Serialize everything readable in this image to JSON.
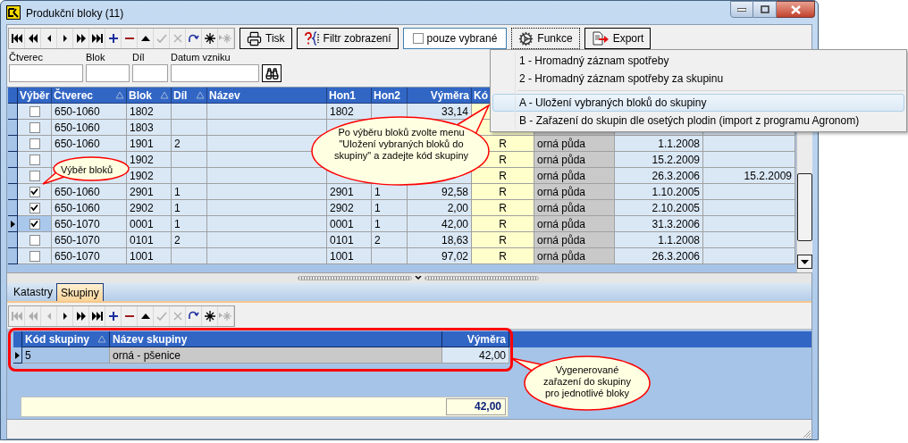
{
  "window": {
    "title": "Produkční bloky (11)"
  },
  "toolbar": {
    "nav_buttons": [
      {
        "kind": "first",
        "disabled": false
      },
      {
        "kind": "prev_page",
        "disabled": false
      },
      {
        "kind": "prev",
        "disabled": false
      },
      {
        "kind": "next",
        "disabled": false
      },
      {
        "kind": "next_page",
        "disabled": false
      },
      {
        "kind": "last",
        "disabled": false
      },
      {
        "kind": "add",
        "disabled": false
      },
      {
        "kind": "delete",
        "disabled": false
      },
      {
        "kind": "up",
        "disabled": false
      },
      {
        "kind": "confirm",
        "disabled": true
      },
      {
        "kind": "cancel",
        "disabled": true
      },
      {
        "kind": "refresh",
        "disabled": false
      },
      {
        "kind": "new",
        "disabled": false
      },
      {
        "kind": "insert",
        "disabled": true
      }
    ],
    "buttons": [
      {
        "kind": "print",
        "label": "Tisk",
        "focused": false
      },
      {
        "kind": "filter",
        "label": "Filtr zobrazení",
        "focused": false
      },
      {
        "kind": "check",
        "label": "pouze vybrané",
        "checked": false,
        "focused": false
      },
      {
        "kind": "functions",
        "label": "Funkce",
        "focused": true
      },
      {
        "kind": "export",
        "label": "Export",
        "focused": false
      }
    ]
  },
  "filters": [
    {
      "label": "Čtverec"
    },
    {
      "label": "Blok"
    },
    {
      "label": "Díl"
    },
    {
      "label": "Datum vzniku"
    }
  ],
  "grid": {
    "columns": [
      {
        "label": "Výběr",
        "sortable": false
      },
      {
        "label": "Čtverec",
        "sortable": true
      },
      {
        "label": "Blok",
        "sortable": true
      },
      {
        "label": "Díl",
        "sortable": true
      },
      {
        "label": "Název",
        "sortable": false
      },
      {
        "label": "Hon1",
        "sortable": false
      },
      {
        "label": "Hon2",
        "sortable": false
      },
      {
        "label": "Výměra",
        "sortable": false
      },
      {
        "label": "Kó"
      }
    ],
    "rows": [
      {
        "checked": false,
        "current": false,
        "cells": [
          "",
          "650-1060",
          "1802",
          "",
          "",
          "1802",
          "",
          "33,14",
          "",
          null,
          null,
          null
        ]
      },
      {
        "checked": false,
        "current": false,
        "cells": [
          "",
          "650-1060",
          "1803",
          "",
          "",
          "",
          null,
          "",
          "",
          "",
          "",
          ""
        ]
      },
      {
        "checked": false,
        "current": false,
        "cells": [
          "",
          "650-1060",
          "1901",
          "2",
          "",
          "",
          "",
          "",
          "R",
          "orná půda",
          "1.1.2008",
          ""
        ]
      },
      {
        "checked": false,
        "current": false,
        "cells": [
          "",
          "",
          "1902",
          "",
          "",
          "",
          "",
          "",
          "R",
          "orná půda",
          "15.2.2009",
          ""
        ]
      },
      {
        "checked": false,
        "current": false,
        "cells": [
          "",
          "",
          "1902",
          "",
          "",
          "",
          "",
          "",
          "R",
          "orná půda",
          "26.3.2006",
          "15.2.2009"
        ]
      },
      {
        "checked": true,
        "current": false,
        "cells": [
          "",
          "650-1060",
          "2901",
          "1",
          "",
          "2901",
          "1",
          "92,58",
          "R",
          "orná půda",
          "1.10.2005",
          ""
        ]
      },
      {
        "checked": true,
        "current": false,
        "cells": [
          "",
          "650-1060",
          "2902",
          "1",
          "",
          "2902",
          "1",
          "2,00",
          "R",
          "orná půda",
          "2.10.2005",
          ""
        ]
      },
      {
        "checked": true,
        "current": true,
        "cells": [
          "",
          "650-1070",
          "0001",
          "1",
          "",
          "0001",
          "1",
          "42,00",
          "R",
          "orná půda",
          "31.3.2006",
          ""
        ]
      },
      {
        "checked": false,
        "current": false,
        "cells": [
          "",
          "650-1070",
          "0101",
          "2",
          "",
          "0101",
          "2",
          "18,63",
          "R",
          "orná půda",
          "1.1.2008",
          ""
        ]
      },
      {
        "checked": false,
        "current": false,
        "cells": [
          "",
          "650-1070",
          "1001",
          "",
          "",
          "1001",
          "",
          "97,02",
          "R",
          "orná půda",
          "26.3.2006",
          ""
        ]
      }
    ]
  },
  "menu": {
    "items": [
      {
        "kind": "item",
        "label": "1 - Hromadný záznam spotřeby",
        "selected": false
      },
      {
        "kind": "item",
        "label": "2 - Hromadný záznam spotřeby za skupinu",
        "selected": false
      },
      {
        "kind": "separator"
      },
      {
        "kind": "item",
        "label": "A - Uložení vybraných bloků do skupiny",
        "selected": true
      },
      {
        "kind": "item",
        "label": "B - Zařazení do skupin dle osetých plodin (import z programu Agronom)",
        "selected": false
      }
    ]
  },
  "tabs": [
    {
      "label": "Katastry",
      "selected": false
    },
    {
      "label": "Skupiny",
      "selected": true
    }
  ],
  "detail_toolbar": [
    {
      "kind": "first",
      "disabled": true
    },
    {
      "kind": "prev_page",
      "disabled": true
    },
    {
      "kind": "prev",
      "disabled": true
    },
    {
      "kind": "next",
      "disabled": false
    },
    {
      "kind": "next_page",
      "disabled": false
    },
    {
      "kind": "last",
      "disabled": false
    },
    {
      "kind": "add",
      "disabled": false
    },
    {
      "kind": "delete",
      "disabled": false
    },
    {
      "kind": "up",
      "disabled": false
    },
    {
      "kind": "confirm",
      "disabled": true
    },
    {
      "kind": "cancel",
      "disabled": true
    },
    {
      "kind": "refresh",
      "disabled": false
    },
    {
      "kind": "new",
      "disabled": false
    },
    {
      "kind": "insert",
      "disabled": true
    }
  ],
  "group_grid": {
    "columns": [
      {
        "label": "Kód skupiny",
        "sortable": true
      },
      {
        "label": "Název skupiny",
        "sortable": false
      },
      {
        "label": "Výměra",
        "sortable": false
      }
    ],
    "rows": [
      {
        "current": true,
        "cells": [
          "5",
          "orná - pšenice",
          "42,00"
        ]
      }
    ]
  },
  "total": "42,00",
  "callouts": [
    {
      "text": "Výběr bloků"
    },
    {
      "text": "Po výběru bloků zvolte menu \"Uložení vybraných bloků do skupiny\" a zadejte kód skupiny"
    },
    {
      "text": "Vygenerované zařazení do skupiny pro jednotlivé bloky"
    }
  ]
}
